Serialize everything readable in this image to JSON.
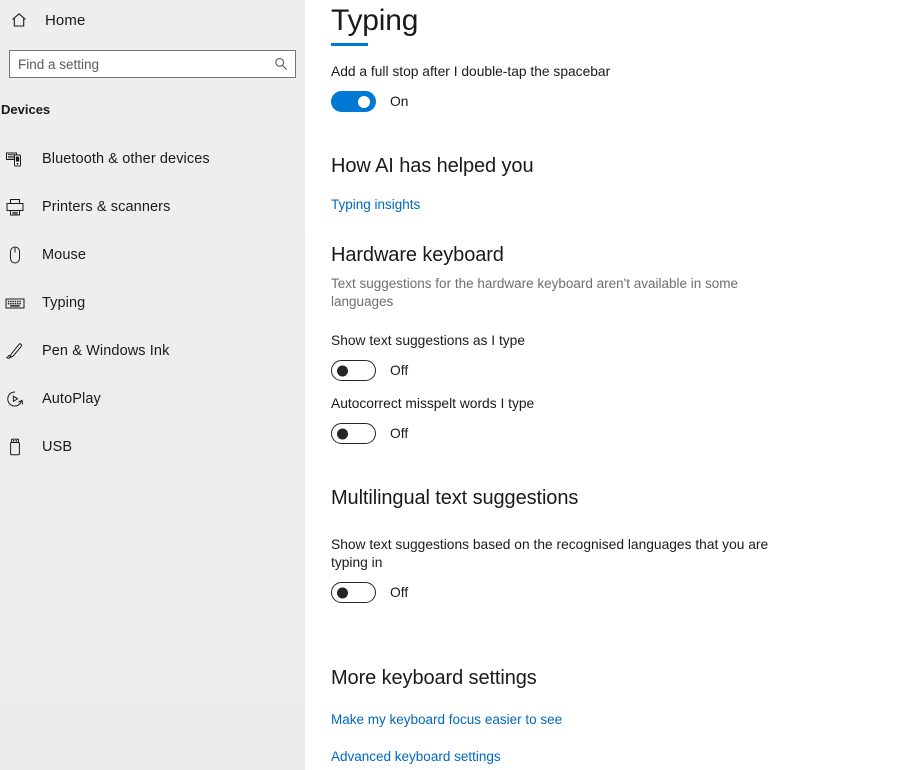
{
  "sidebar": {
    "home": {
      "label": "Home",
      "icon": "home-icon"
    },
    "search": {
      "placeholder": "Find a setting",
      "value": "",
      "icon": "search-icon"
    },
    "group_title": "Devices",
    "items": [
      {
        "label": "Bluetooth & other devices",
        "icon": "bluetooth-devices-icon",
        "selected": false
      },
      {
        "label": "Printers & scanners",
        "icon": "printer-icon",
        "selected": false
      },
      {
        "label": "Mouse",
        "icon": "mouse-icon",
        "selected": false
      },
      {
        "label": "Typing",
        "icon": "keyboard-icon",
        "selected": true
      },
      {
        "label": "Pen & Windows Ink",
        "icon": "pen-icon",
        "selected": false
      },
      {
        "label": "AutoPlay",
        "icon": "autoplay-icon",
        "selected": false
      },
      {
        "label": "USB",
        "icon": "usb-icon",
        "selected": false
      }
    ]
  },
  "page": {
    "title": "Typing",
    "accent_color": "#0078d4",
    "link_color": "#0067c0"
  },
  "spacebar_setting": {
    "label": "Add a full stop after I double-tap the spacebar",
    "state": "On",
    "on": true
  },
  "ai_section": {
    "heading": "How AI has helped you",
    "link": "Typing insights"
  },
  "hardware_keyboard": {
    "heading": "Hardware keyboard",
    "description": "Text suggestions for the hardware keyboard aren't available in some languages",
    "settings": [
      {
        "label": "Show text suggestions as I type",
        "state": "Off",
        "on": false
      },
      {
        "label": "Autocorrect misspelt words I type",
        "state": "Off",
        "on": false
      }
    ]
  },
  "multilingual": {
    "heading": "Multilingual text suggestions",
    "setting": {
      "label": "Show text suggestions based on the recognised languages that you are typing in",
      "state": "Off",
      "on": false
    }
  },
  "more_keyboard": {
    "heading": "More keyboard settings",
    "links": [
      "Make my keyboard focus easier to see",
      "Advanced keyboard settings"
    ]
  }
}
